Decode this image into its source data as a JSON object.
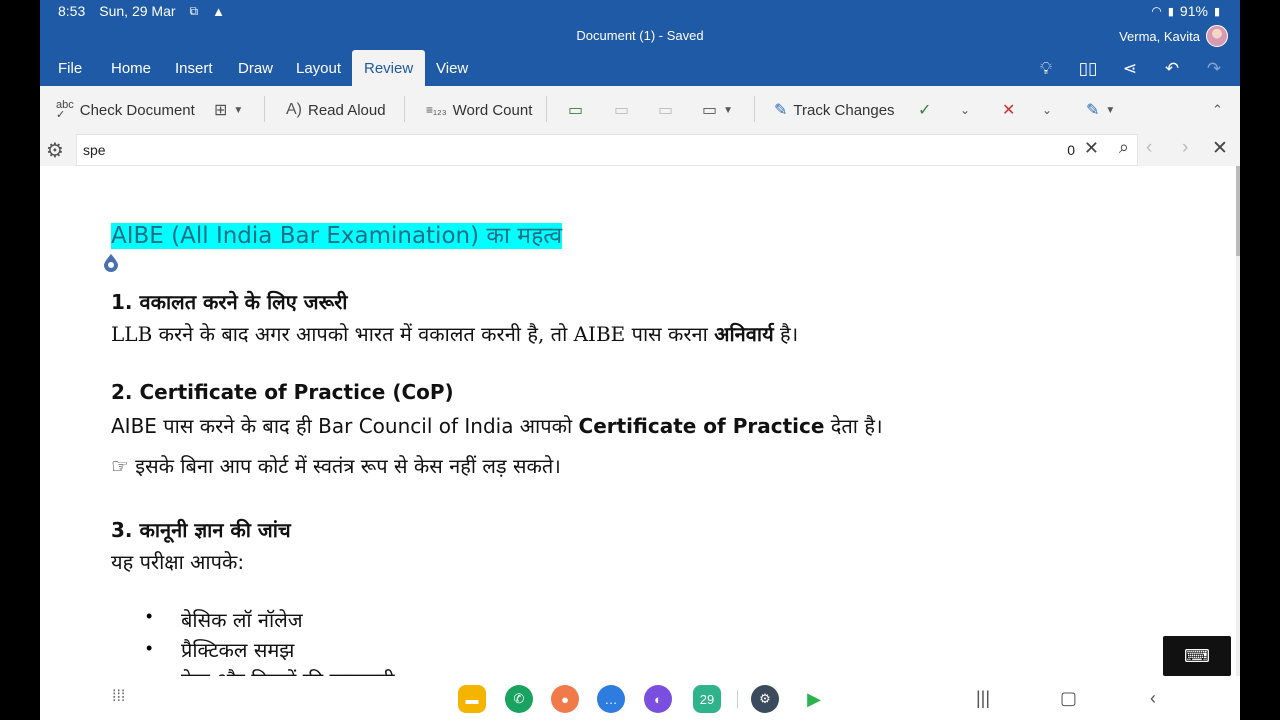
{
  "status": {
    "time": "8:53",
    "date": "Sun, 29 Mar",
    "battery": "91%"
  },
  "titlebar": {
    "title": "Document (1) - Saved",
    "user": "Verma, Kavita"
  },
  "tabs": [
    "File",
    "Home",
    "Insert",
    "Draw",
    "Layout",
    "Review",
    "View"
  ],
  "active_tab": "Review",
  "ribbon": {
    "check_document": "Check Document",
    "read_aloud": "Read Aloud",
    "word_count": "Word Count",
    "track_changes": "Track Changes"
  },
  "find": {
    "query": "spe",
    "count": "0"
  },
  "doc": {
    "heading": "AIBE (All India Bar Examination) का महत्व",
    "s1_title": "1. वकालत करने के लिए जरूरी",
    "s1_pre": "LLB करने के बाद अगर आपको भारत में वकालत करनी है, तो AIBE पास करना ",
    "s1_bold": "अनिवार्य",
    "s1_post": " है।",
    "s2_title": "2. Certificate of Practice (CoP)",
    "s2_pre": "AIBE पास करने के बाद ही Bar Council of India आपको ",
    "s2_bold": "Certificate of Practice",
    "s2_post": " देता है।",
    "s2_note": "☞ इसके बिना आप कोर्ट में स्वतंत्र रूप से केस नहीं लड़ सकते।",
    "s3_title": "3. कानूनी ज्ञान की जांच",
    "s3_intro": "यह परीक्षा आपके:",
    "bullets": [
      "बेसिक लॉ नॉलेज",
      "प्रैक्टिकल समझ",
      "केस और नियमों की जानकारी"
    ]
  },
  "taskbar": {
    "calendar_day": "29"
  }
}
